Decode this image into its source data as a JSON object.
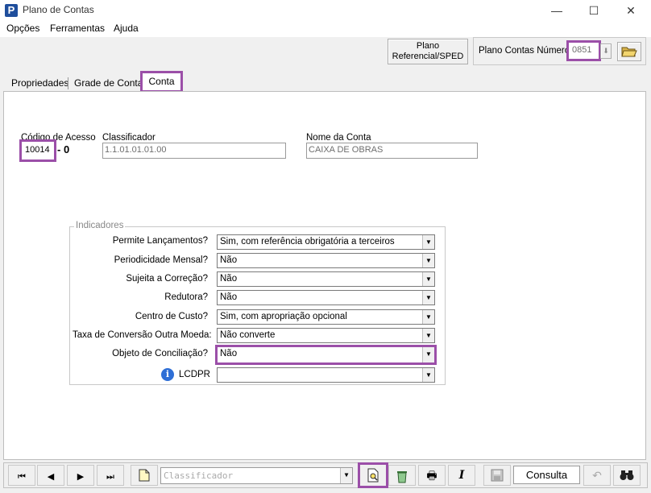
{
  "window": {
    "title": "Plano de Contas",
    "app_icon_letter": "P",
    "minimize": "—",
    "maximize": "☐",
    "close": "✕"
  },
  "menu": {
    "items": [
      "Opções",
      "Ferramentas",
      "Ajuda"
    ]
  },
  "header": {
    "plano_ref_line1": "Plano",
    "plano_ref_line2": "Referencial/SPED",
    "plano_contas_label": "Plano Contas Número",
    "plano_contas_value": "0851"
  },
  "tabs": [
    {
      "label": "Propriedades",
      "active": false
    },
    {
      "label": "Grade de Contas",
      "active": false
    },
    {
      "label": "Conta",
      "active": true
    }
  ],
  "conta": {
    "codigo_label": "Código de Acesso",
    "codigo_value": "10014",
    "codigo_suffix": "- 0",
    "classificador_label": "Classificador",
    "classificador_value": "1.1.01.01.01.00",
    "nome_label": "Nome da Conta",
    "nome_value": "CAIXA DE OBRAS"
  },
  "indicadores": {
    "title": "Indicadores",
    "rows": [
      {
        "label": "Permite Lançamentos?",
        "value": "Sim, com referência obrigatória a terceiros"
      },
      {
        "label": "Periodicidade Mensal?",
        "value": "Não"
      },
      {
        "label": "Sujeita a Correção?",
        "value": "Não"
      },
      {
        "label": "Redutora?",
        "value": "Não"
      },
      {
        "label": "Centro de Custo?",
        "value": "Sim, com apropriação opcional"
      },
      {
        "label": "Taxa de Conversão Outra Moeda:",
        "value": "Não converte"
      },
      {
        "label": "Objeto de Conciliação?",
        "value": "Não"
      },
      {
        "label": "LCDPR",
        "value": ""
      }
    ]
  },
  "toolbar": {
    "search_placeholder": "Classificador",
    "mode_label": "Consulta",
    "icons": {
      "first": "⏮",
      "prev": "◀",
      "next": "▶",
      "last": "⏭",
      "new": "🗋",
      "save": "💾",
      "print": "🖶",
      "italic": "I",
      "undo": "↶",
      "find": "🔭"
    }
  },
  "colors": {
    "highlight": "#9b4fa8",
    "accent": "#1f4e9c",
    "info": "#2f6fd6"
  }
}
